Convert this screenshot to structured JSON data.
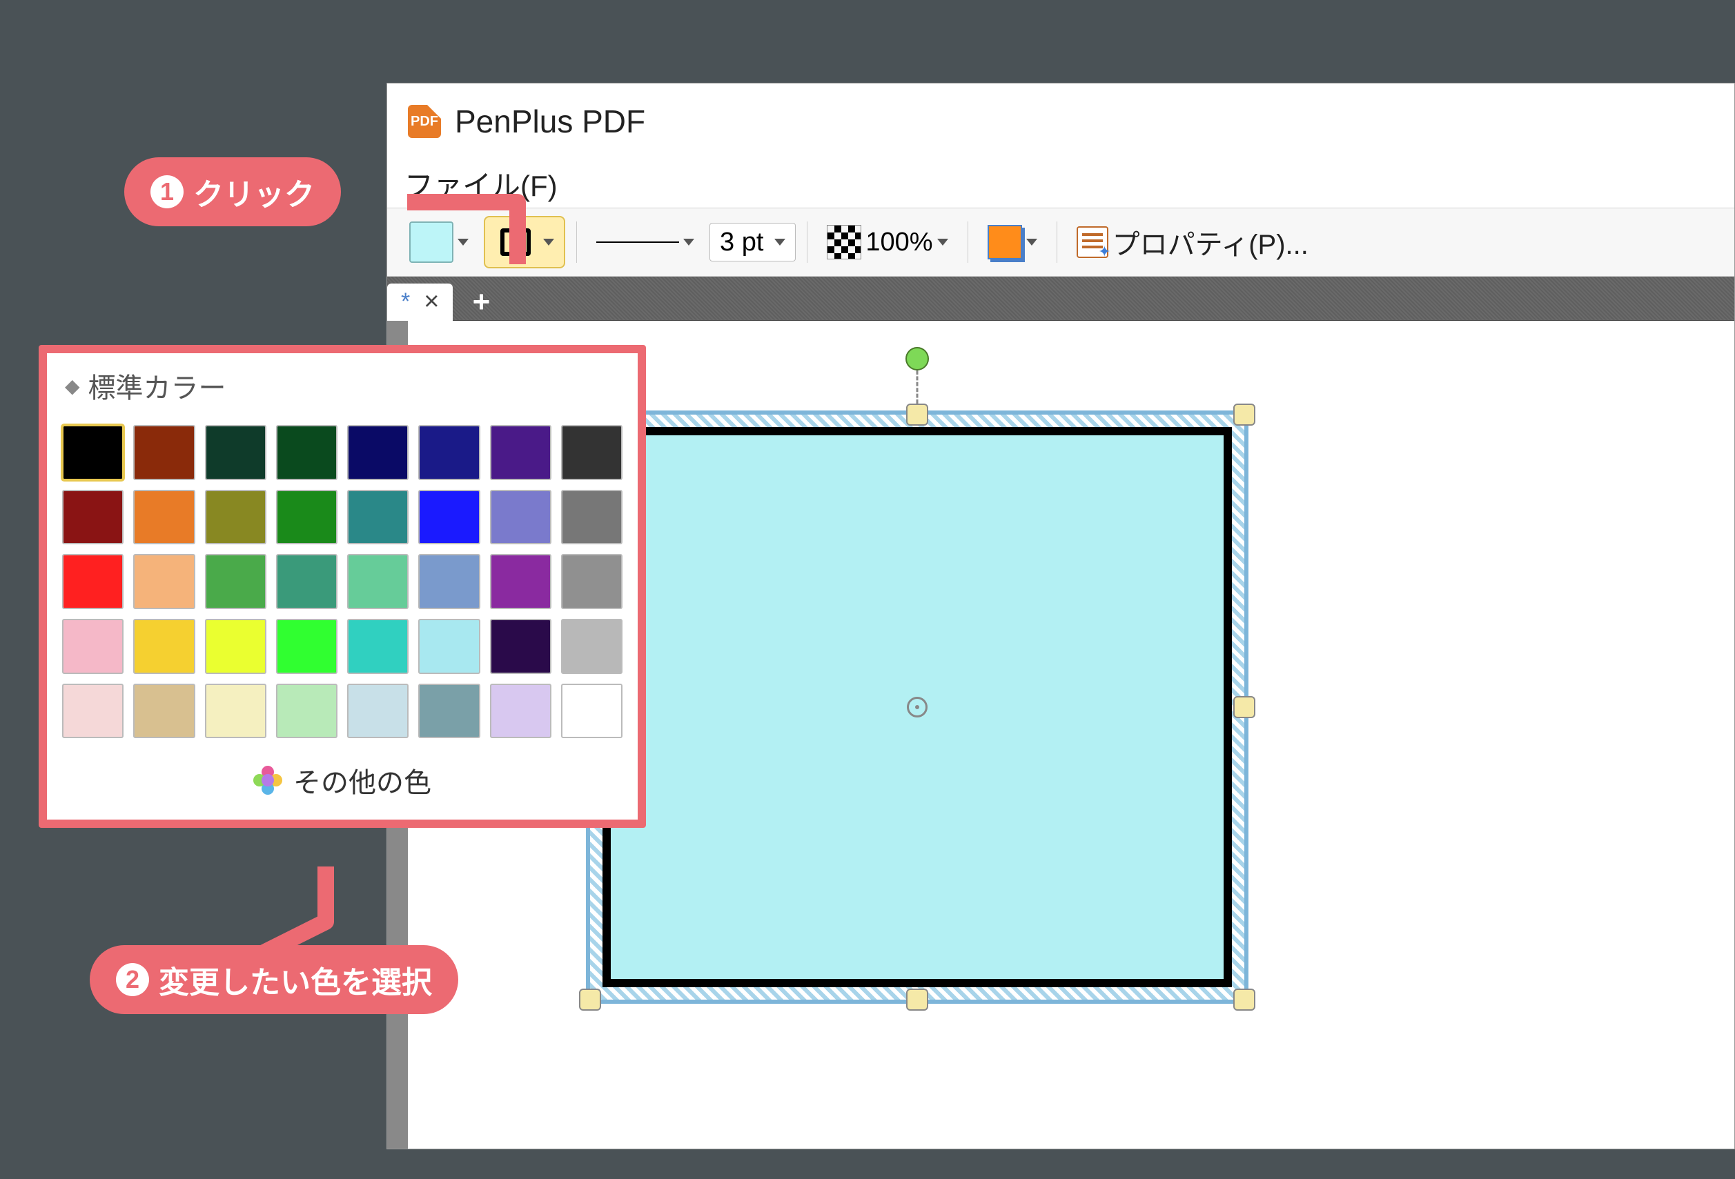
{
  "app": {
    "title": "PenPlus PDF",
    "menu_file": "ファイル(F)"
  },
  "toolbar": {
    "line_weight": "3 pt",
    "opacity": "100%",
    "properties_label": "プロパティ(P)..."
  },
  "tab": {
    "dirty_mark": "*",
    "close": "×",
    "add": "+"
  },
  "popup": {
    "header": "標準カラー",
    "more_colors": "その他の色",
    "colors": [
      "#000000",
      "#8a2a0a",
      "#0f3b2a",
      "#0a4a1e",
      "#0a0a66",
      "#1a1a88",
      "#4a1a88",
      "#333333",
      "#8a1414",
      "#e87b27",
      "#888822",
      "#1a8a1a",
      "#2a8888",
      "#1a1aff",
      "#7a7acc",
      "#777777",
      "#ff2020",
      "#f5b37a",
      "#4aaa4a",
      "#3a9a7a",
      "#66cc99",
      "#7a9acc",
      "#8a2aa0",
      "#909090",
      "#f5b8c8",
      "#f5d030",
      "#eaff30",
      "#30ff30",
      "#30d0c0",
      "#a8e8f0",
      "#2a0a4a",
      "#b8b8b8",
      "#f5d8d8",
      "#d8c090",
      "#f5f0c0",
      "#b8eab8",
      "#c8e0e8",
      "#7aa0a8",
      "#d8c8f0",
      "#ffffff"
    ]
  },
  "callouts": {
    "c1_num": "1",
    "c1_text": "クリック",
    "c2_num": "2",
    "c2_text": "変更したい色を選択"
  }
}
